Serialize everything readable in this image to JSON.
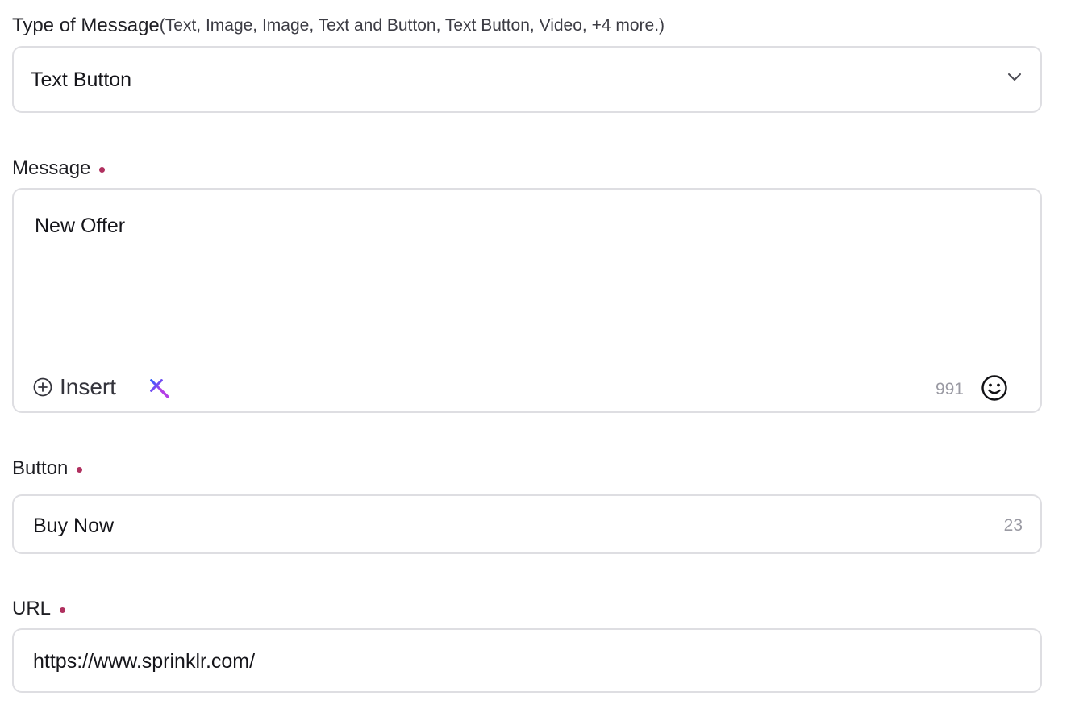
{
  "type_field": {
    "label": "Type of Message",
    "hint": "(Text, Image, Image, Text and Button, Text Button, Video, +4 more.)",
    "value": "Text Button",
    "icon": "chevron-down-icon"
  },
  "message_field": {
    "label": "Message",
    "value": "New Offer",
    "insert_label": "Insert",
    "insert_icon": "plus-circle-icon",
    "ai_icon": "sparkle-wand-icon",
    "char_count": "991",
    "emoji_icon": "emoji-smile-icon"
  },
  "button_field": {
    "label": "Button",
    "value": "Buy Now",
    "char_count": "23"
  },
  "url_field": {
    "label": "URL",
    "value": "https://www.sprinklr.com/"
  },
  "colors": {
    "required_dot": "#b0305f",
    "border": "#dedee2",
    "counter_text": "#9a9aa3",
    "sparkle_blue": "#2f5dff",
    "sparkle_purple": "#b33ee6"
  }
}
